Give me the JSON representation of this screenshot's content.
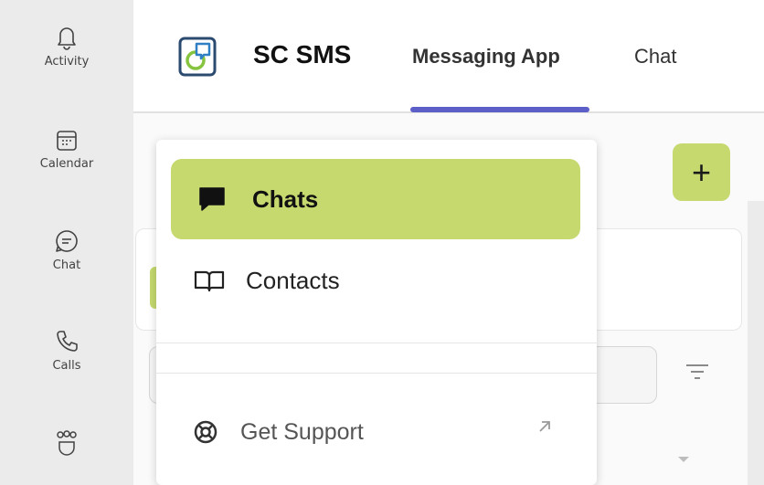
{
  "rail": {
    "items": [
      {
        "label": "Activity",
        "icon": "bell-icon"
      },
      {
        "label": "Calendar",
        "icon": "calendar-icon"
      },
      {
        "label": "Chat",
        "icon": "chat-bubble-icon"
      },
      {
        "label": "Calls",
        "icon": "phone-icon"
      },
      {
        "label": "Teams",
        "icon": "teams-icon"
      }
    ]
  },
  "header": {
    "app_name": "SC SMS",
    "tabs": [
      {
        "label": "Messaging App",
        "active": true
      },
      {
        "label": "Chat",
        "active": false
      }
    ]
  },
  "content": {
    "add_label": "+"
  },
  "menu": {
    "items": [
      {
        "label": "Chats",
        "icon": "chat-square-icon",
        "selected": true
      },
      {
        "label": "Contacts",
        "icon": "book-open-icon",
        "selected": false
      }
    ],
    "support": {
      "label": "Get Support",
      "icon": "lifebuoy-icon",
      "trailing_icon": "external-link-arrow-icon"
    }
  },
  "colors": {
    "accent_green": "#c5d96f",
    "tab_underline": "#5b5fc7",
    "rail_bg": "#ebebeb"
  }
}
